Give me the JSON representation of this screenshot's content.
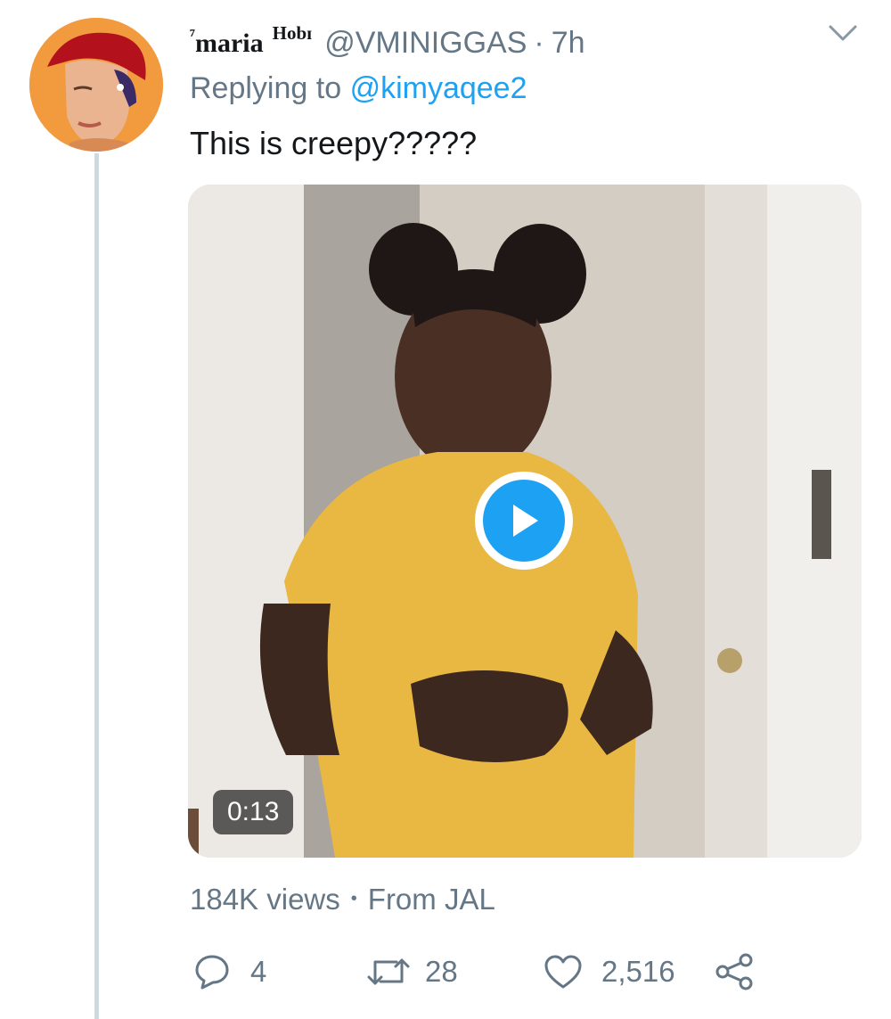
{
  "tweet": {
    "author": {
      "name_prefix": "⁷",
      "name": "maria",
      "name_suffix": "Hobɪ",
      "handle": "@VMINIGGAS",
      "separator": "·",
      "time": "7h",
      "avatar_icon": "avatar-photo"
    },
    "reply": {
      "prefix": "Replying to",
      "mention": "@kimyaqee2"
    },
    "text": "This is creepy?????",
    "media": {
      "type": "video",
      "duration": "0:13",
      "play_icon": "play-icon"
    },
    "meta": {
      "views": "184K views",
      "separator": "•",
      "source": "From JAL"
    },
    "actions": {
      "reply_count": "4",
      "retweet_count": "28",
      "like_count": "2,516",
      "reply_icon": "reply-bubble-icon",
      "retweet_icon": "retweet-icon",
      "like_icon": "heart-icon",
      "share_icon": "share-icon"
    },
    "menu_icon": "chevron-down-icon"
  },
  "colors": {
    "link": "#1da1f2",
    "secondary_text": "#657786",
    "primary_text": "#14171a",
    "thread_line": "#cfd9de"
  }
}
